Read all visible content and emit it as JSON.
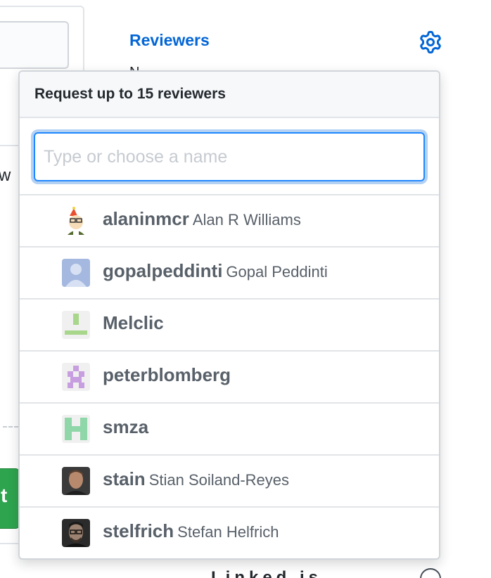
{
  "background": {
    "reviewers_label": "Reviewers",
    "partial_text_w": "w",
    "partial_text_under": "N",
    "partial_button_text": "t",
    "partial_bottom_text": "Linked is",
    "gear_icon": "gear-icon",
    "info_icon": "info-icon"
  },
  "popover": {
    "title": "Request up to 15 reviewers",
    "filter_placeholder": "Type or choose a name",
    "filter_value": "",
    "reviewers": [
      {
        "login": "alaninmcr",
        "name": "Alan R Williams",
        "avatar": "cartoon-avatar"
      },
      {
        "login": "gopalpeddinti",
        "name": "Gopal Peddinti",
        "avatar": "default-person-avatar"
      },
      {
        "login": "Melclic",
        "name": "",
        "avatar": "identicon-green"
      },
      {
        "login": "peterblomberg",
        "name": "",
        "avatar": "identicon-purple"
      },
      {
        "login": "smza",
        "name": "",
        "avatar": "identicon-teal"
      },
      {
        "login": "stain",
        "name": "Stian Soiland-Reyes",
        "avatar": "photo-avatar"
      },
      {
        "login": "stelfrich",
        "name": "Stefan Helfrich",
        "avatar": "photo-avatar-glasses"
      }
    ]
  },
  "colors": {
    "link_blue": "#0366d6",
    "focus_blue": "#2188ff",
    "green_button": "#2ea44f",
    "muted_text": "#586069"
  }
}
